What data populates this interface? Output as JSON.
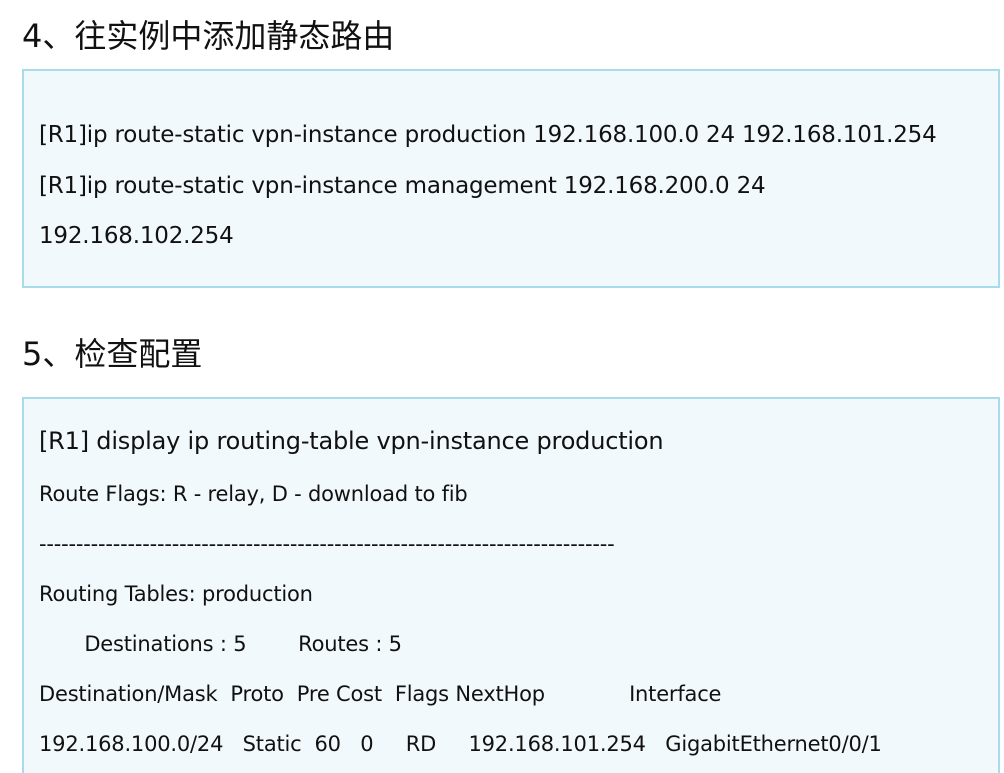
{
  "section4": {
    "title": "4、往实例中添加静态路由",
    "lines": [
      "[R1]ip route-static vpn-instance production 192.168.100.0 24 192.168.101.254",
      "[R1]ip route-static vpn-instance management 192.168.200.0 24",
      "192.168.102.254"
    ]
  },
  "section5": {
    "title": "5、检查配置",
    "lines": [
      "[R1] display ip routing-table vpn-instance production",
      "Route Flags: R - relay, D - download to fib",
      "------------------------------------------------------------------------------",
      "Routing Tables: production",
      "       Destinations : 5        Routes : 5",
      "Destination/Mask  Proto  Pre Cost  Flags NextHop             Interface",
      "192.168.100.0/24   Static  60   0     RD     192.168.101.254   GigabitEthernet0/0/1"
    ]
  },
  "colors": {
    "box_background": "#f2f9fd",
    "box_border": "#a9dcea"
  }
}
